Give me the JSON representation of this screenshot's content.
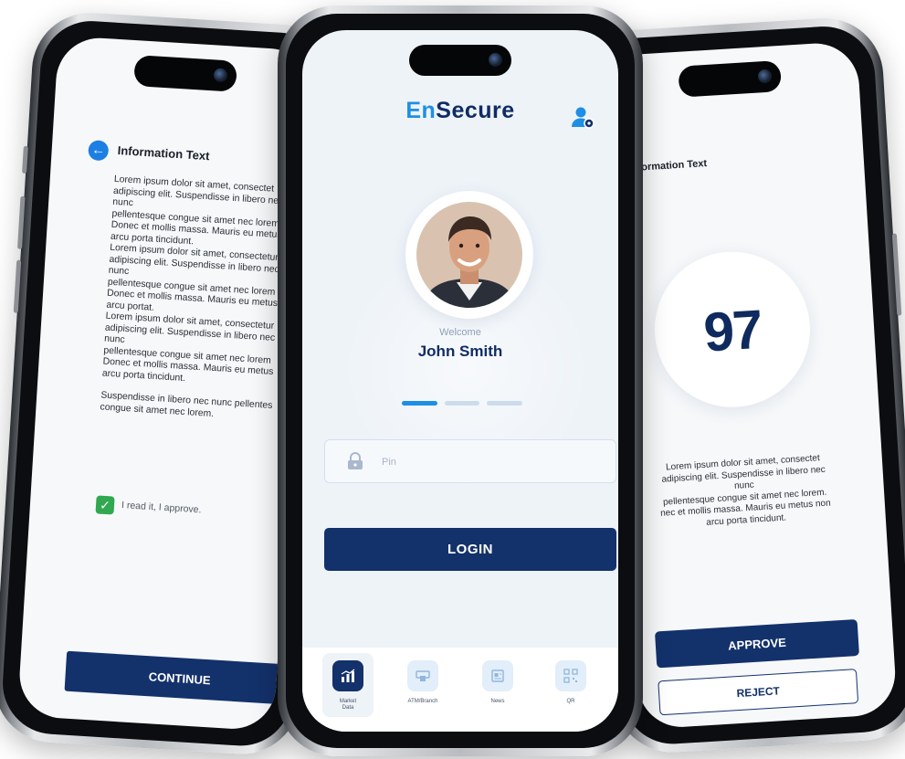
{
  "left_screen": {
    "title": "Information Text",
    "paragraphs": [
      "Lorem ipsum dolor sit amet, consectet\nadipiscing elit. Suspendisse in libero nec,\nnunc\npellentesque congue sit amet nec lorem\nDonec et mollis massa. Mauris eu metus\narcu porta tincidunt.\nLorem ipsum dolor sit amet, consectetur\nadipiscing elit. Suspendisse in libero nec\nnunc\npellentesque congue sit amet nec lorem\nDonec et mollis massa. Mauris eu metus\narcu portat.\nLorem ipsum dolor sit amet, consectetur\nadipiscing elit. Suspendisse in libero nec\nnunc\npellentesque congue sit amet nec lorem\nDonec et mollis massa. Mauris eu metus\narcu porta tincidunt.",
      "Suspendisse in libero nec nunc pellentes\ncongue sit amet nec lorem."
    ],
    "checkbox_label": "I read it, I approve.",
    "checkbox_checked": true,
    "continue_label": "CONTINUE"
  },
  "center_screen": {
    "logo_en": "En",
    "logo_secure": "Secure",
    "welcome": "Welcome",
    "user_name": "John Smith",
    "pin_placeholder": "Pin",
    "login_label": "LOGIN",
    "active_step": 1,
    "step_count": 3,
    "nav": [
      {
        "label": "Market\nData",
        "icon": "chart-icon",
        "active": true
      },
      {
        "label": "ATM/Branch",
        "icon": "atm-icon",
        "active": false
      },
      {
        "label": "News",
        "icon": "news-icon",
        "active": false
      },
      {
        "label": "QR",
        "icon": "qr-icon",
        "active": false
      }
    ]
  },
  "right_screen": {
    "title": "nformation Text",
    "score": "97",
    "text": "Lorem ipsum dolor sit amet, consectet\nadipiscing elit. Suspendisse in libero nec\nnunc\npellentesque congue sit amet nec lorem.\nnec et mollis massa. Mauris eu metus non\narcu porta tincidunt.",
    "approve_label": "APPROVE",
    "reject_label": "REJECT"
  },
  "colors": {
    "primary_navy": "#13316b",
    "brand_blue": "#1e8fe5",
    "check_green": "#2fa84f",
    "step_inactive": "#cddcec"
  }
}
